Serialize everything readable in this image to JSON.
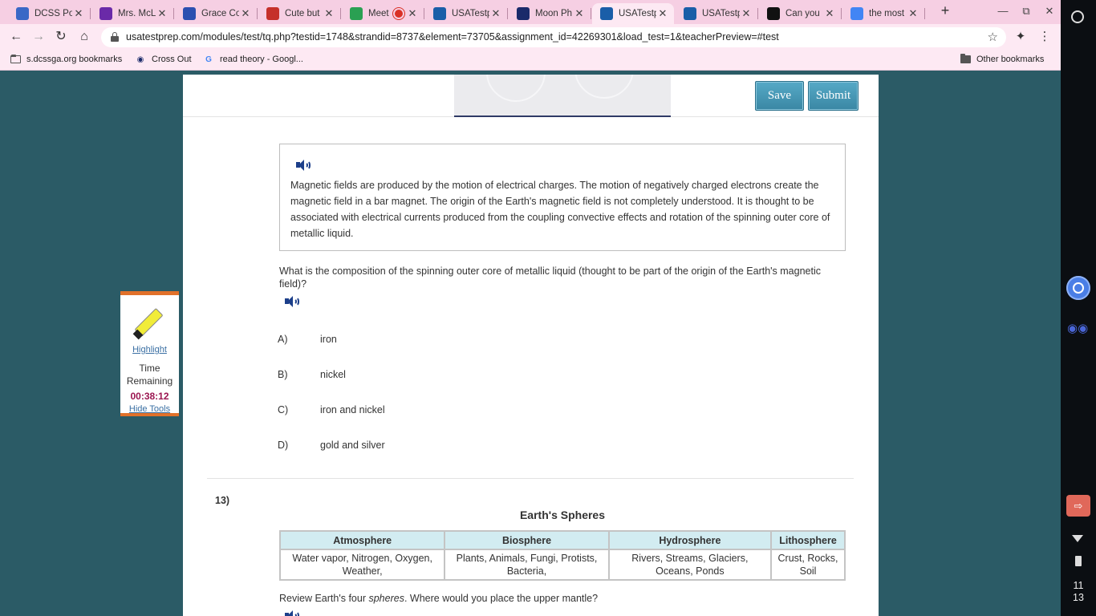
{
  "tabs": [
    {
      "label": "DCSS Por",
      "favicon_color": "#3a68c6",
      "active": false
    },
    {
      "label": "Mrs. McL",
      "favicon_color": "#6a2aa8",
      "active": false
    },
    {
      "label": "Grace Co",
      "favicon_color": "#2b4fb0",
      "active": false
    },
    {
      "label": "Cute but",
      "favicon_color": "#c5302a",
      "active": false
    },
    {
      "label": "Meet",
      "favicon_color": "#2aa052",
      "active": false,
      "recording": true
    },
    {
      "label": "USATestp",
      "favicon_color": "#1a5ea8",
      "active": false
    },
    {
      "label": "Moon Ph",
      "favicon_color": "#1a2a6a",
      "active": false
    },
    {
      "label": "USATestp",
      "favicon_color": "#1a5ea8",
      "active": true
    },
    {
      "label": "USATestp",
      "favicon_color": "#1a5ea8",
      "active": false
    },
    {
      "label": "Can you",
      "favicon_color": "#111111",
      "active": false
    },
    {
      "label": "the most",
      "favicon_color": "#4285f4",
      "active": false
    }
  ],
  "address_bar": {
    "url": "usatestprep.com/modules/test/tq.php?testid=1748&strandid=8737&element=73705&assignment_id=42269301&load_test=1&teacherPreview=#test"
  },
  "bookmarks": [
    {
      "label": "s.dcssga.org bookmarks",
      "icon": "folder-icon"
    },
    {
      "label": "Cross Out",
      "icon": "owl-icon"
    },
    {
      "label": "read theory - Googl...",
      "icon": "google-icon"
    },
    {
      "label": "Other bookmarks",
      "icon": "folder-icon"
    }
  ],
  "header": {
    "save_label": "Save",
    "submit_label": "Submit"
  },
  "passage": {
    "text": "Magnetic fields are produced by the motion of electrical charges. The motion of negatively charged electrons create the magnetic field in a bar magnet. The origin of the Earth's magnetic field is not completely understood. It is thought to be associated with electrical currents produced from the coupling convective effects and rotation of the spinning outer core of metallic liquid."
  },
  "question": {
    "text": "What is the composition of the spinning outer core of metallic liquid (thought to be part of the origin of the Earth's magnetic field)?",
    "choices": [
      {
        "letter": "A)",
        "text": "iron"
      },
      {
        "letter": "B)",
        "text": "nickel"
      },
      {
        "letter": "C)",
        "text": "iron and nickel"
      },
      {
        "letter": "D)",
        "text": "gold and silver"
      }
    ]
  },
  "next_question": {
    "number": "13)",
    "table_title": "Earth's Spheres",
    "columns": [
      "Atmosphere",
      "Biosphere",
      "Hydrosphere",
      "Lithosphere"
    ],
    "cells": [
      "Water vapor, Nitrogen, Oxygen, Weather,",
      "Plants, Animals, Fungi, Protists, Bacteria,",
      "Rivers, Streams, Glaciers, Oceans, Ponds",
      "Crust, Rocks, Soil"
    ],
    "prompt_before": "Review Earth's four ",
    "prompt_emph": "spheres",
    "prompt_after": ". Where would you place the upper mantle?"
  },
  "tools": {
    "highlight_label": "Highlight",
    "time_label_1": "Time",
    "time_label_2": "Remaining",
    "timer": "00:38:12",
    "hide_label": "Hide Tools"
  },
  "shelf": {
    "time_hour": "11",
    "time_minute": "13"
  }
}
